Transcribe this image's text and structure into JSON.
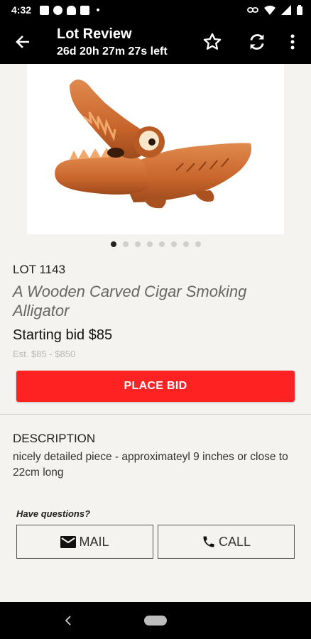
{
  "status_bar": {
    "time": "4:32",
    "left_icons": [
      "notification-icon",
      "play-icon",
      "android-icon",
      "notification-icon"
    ],
    "right_icons": [
      "link-icon",
      "wifi-icon",
      "signal-icon",
      "battery-icon"
    ]
  },
  "app_bar": {
    "title": "Lot Review",
    "countdown": "26d 20h 27m 27s left",
    "actions": [
      "star-icon",
      "refresh-icon",
      "more-vert-icon"
    ]
  },
  "gallery": {
    "image_subject": "wooden carved alligator",
    "page_count": 8,
    "active_index": 0
  },
  "lot": {
    "number": "LOT 1143",
    "title": "A Wooden Carved Cigar Smoking Alligator",
    "starting_bid": "Starting bid $85",
    "estimate": "Est. $85 - $850"
  },
  "actions": {
    "place_bid": "PLACE BID"
  },
  "description": {
    "heading": "DESCRIPTION",
    "body": "nicely detailed piece - approximateyl 9 inches or close to 22cm long"
  },
  "contact": {
    "prompt": "Have questions?",
    "mail_label": "MAIL",
    "call_label": "CALL"
  },
  "colors": {
    "accent": "#ff2222",
    "bar": "#000000",
    "background": "#f4f3ef"
  }
}
